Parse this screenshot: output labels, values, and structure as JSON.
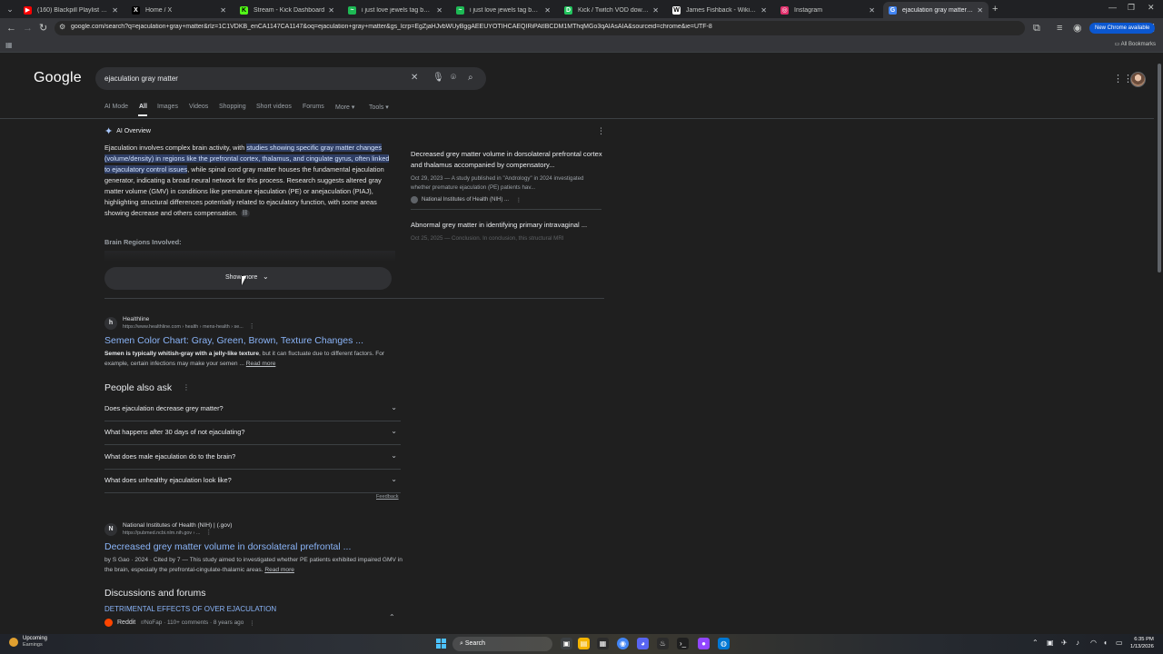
{
  "tabs": [
    {
      "title": "(160) Blackpill Playlist to just bu",
      "favicon_color": "#ff0000",
      "favicon_glyph": "▶"
    },
    {
      "title": "Home / X",
      "favicon_color": "#000000",
      "favicon_glyph": "X"
    },
    {
      "title": "Stream - Kick Dashboard",
      "favicon_color": "#53fc18",
      "favicon_glyph": "K"
    },
    {
      "title": "i just love jewels tag by money",
      "favicon_color": "#1db954",
      "favicon_glyph": "~"
    },
    {
      "title": "i just love jewels tag by money",
      "favicon_color": "#1db954",
      "favicon_glyph": "~"
    },
    {
      "title": "Kick / Twitch VOD downloader",
      "favicon_color": "#22c55e",
      "favicon_glyph": "D"
    },
    {
      "title": "James Fishback - Wikipedia",
      "favicon_color": "#ffffff",
      "favicon_glyph": "W"
    },
    {
      "title": "Instagram",
      "favicon_color": "#e1306c",
      "favicon_glyph": "◎"
    },
    {
      "title": "ejaculation gray matter - Goog",
      "favicon_color": "#4285f4",
      "favicon_glyph": "G",
      "active": true
    }
  ],
  "toolbar": {
    "url": "google.com/search?q=ejaculation+gray+matter&rlz=1C1VDKB_enCA1147CA1147&oq=ejaculation+gray+matter&gs_lcrp=EgZjaHJvbWUyBggAEEUYOTIHCAEQIRiPAtIBCDM1MThqMGo3qAIAsAIA&sourceid=chrome&ie=UTF-8",
    "new_chrome": "New Chrome available",
    "all_bookmarks": "All Bookmarks"
  },
  "google": {
    "logo": "Google",
    "query": "ejaculation gray matter",
    "nav_tabs": [
      "AI Mode",
      "All",
      "Images",
      "Videos",
      "Shopping",
      "Short videos",
      "Forums",
      "More",
      "Tools"
    ]
  },
  "ai_overview": {
    "title": "AI Overview",
    "text_a": "Ejaculation involves complex brain activity, with ",
    "text_highlight": "studies showing specific gray matter changes (volume/density) in regions like the prefrontal cortex, thalamus, and cingulate gyrus, often linked to ejaculatory control issues",
    "text_b": ", while spinal cord gray matter houses the fundamental ejaculation generator, indicating a broad neural network for this process. Research suggests altered gray matter volume (GMV) in conditions like premature ejaculation (PE) or anejaculation (PIAJ), highlighting structural differences potentially related to ejaculatory function, with some areas showing decrease and others compensation.",
    "subheading": "Brain Regions Involved:",
    "show_more": "Show more",
    "cards": [
      {
        "title": "Decreased grey matter volume in dorsolateral prefrontal cortex and thalamus accompanied by compensatory...",
        "snippet": "Oct 29, 2023 — A study published in \"Andrology\" in 2024 investigated whether premature ejaculation (PE) patients hav...",
        "source": "National Institutes of Health (NIH) ..."
      },
      {
        "title": "Abnormal grey matter in identifying primary intravaginal ...",
        "snippet": "Oct 25, 2025 — Conclusion. In conclusion, this structural MRI"
      }
    ]
  },
  "results": [
    {
      "site": "Healthline",
      "url": "https://www.healthline.com › health › mens-health › se...",
      "title": "Semen Color Chart: Gray, Green, Brown, Texture Changes ...",
      "snippet_bold": "Semen is typically whitish-gray with a jelly-like texture",
      "snippet": ", but it can fluctuate due to different factors. For example, certain infections may make your semen ...",
      "read_more": "Read more",
      "favicon": "h"
    },
    {
      "site": "National Institutes of Health (NIH) | (.gov)",
      "url": "https://pubmed.ncbi.nlm.nih.gov › ...",
      "title": "Decreased grey matter volume in dorsolateral prefrontal ...",
      "snippet": "by S Gao · 2024 · Cited by 7 — This study aimed to investigated whether PE patients exhibited impaired GMV in the brain, especially the prefrontal-cingulate-thalamic areas.",
      "read_more": "Read more",
      "favicon": "N"
    }
  ],
  "people_also_ask": {
    "title": "People also ask",
    "questions": [
      "Does ejaculation decrease grey matter?",
      "What happens after 30 days of not ejaculating?",
      "What does male ejaculation do to the brain?",
      "What does unhealthy ejaculation look like?"
    ],
    "feedback": "Feedback"
  },
  "discussions": {
    "title": "Discussions and forums",
    "link": "DETRIMENTAL EFFECTS OF OVER EJACULATION",
    "source": "Reddit",
    "meta": "r/NoFap · 110+ comments · 8 years ago"
  },
  "taskbar": {
    "weather_line1": "Upcoming",
    "weather_line2": "Earnings",
    "search": "Search",
    "time": "6:35 PM",
    "date": "1/13/2026"
  }
}
